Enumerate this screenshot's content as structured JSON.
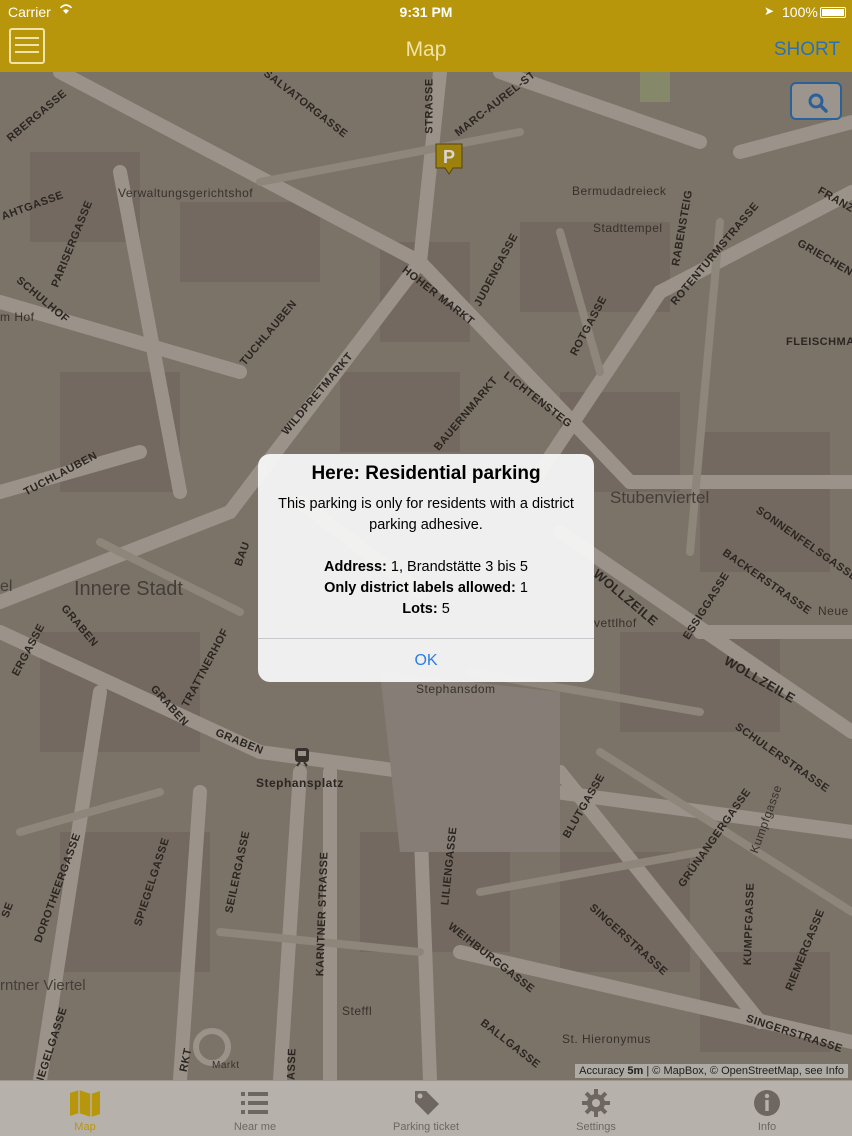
{
  "status": {
    "carrier": "Carrier",
    "time": "9:31 PM",
    "battery": "100%"
  },
  "nav": {
    "title": "Map",
    "right_button": "SHORT"
  },
  "map": {
    "labels": {
      "verwaltung": "Verwaltungsgerichtshof",
      "bermuda": "Bermudadreieck",
      "stadttempel": "Stadttempel",
      "stubenviertel": "Stubenviertel",
      "innere": "Innere Stadt",
      "stephansdom": "Stephansdom",
      "stephansplatz": "Stephansplatz",
      "steffl": "Steffl",
      "hieronymus": "St. Hieronymus",
      "karntner": "rntner Viertel",
      "neue": "Neue",
      "vettlhof": "vettlhof",
      "mhof": "m Hof",
      "el": "el"
    },
    "streets": {
      "salvator": "SALVATORGASSE",
      "marc": "MARC-AUREL-ST",
      "strasse": "STRASSE",
      "hoher": "HOHER MARKT",
      "juden": "JUDENGASSE",
      "rabenst": "RABENSTEIG",
      "rotenturm": "ROTENTURMSTRASSE",
      "rotg": "ROTGASSE",
      "tuchlauben": "TUCHLAUBEN",
      "tuchlauben2": "TUCHLAUBEN",
      "wildpret": "WILDPRETMARKT",
      "bauern": "BAUERNMARKT",
      "lichten": "LICHTENSTEG",
      "parisergasse": "PARISERGASSE",
      "schulhof": "SCHULHOF",
      "rbergasse": "RBERGASSE",
      "ahtgasse": "AHTGASSE",
      "griechen": "GRIECHEN",
      "franz": "FRANZ",
      "fleisch": "FLEISCHMA",
      "sonnenfels": "SONNENFELSGASSE",
      "backer": "BACKERSTRASSE",
      "essig": "ESSIGGASSE",
      "wollzeile": "WOLLZEILE",
      "wollzeile2": "WOLLZEILE",
      "schuler": "SCHULERSTRASSE",
      "graben": "GRABEN",
      "graben2": "GRABEN",
      "graben3": "GRABEN",
      "trattner": "TRATTNERHOF",
      "ergasse": "ERGASSE",
      "dorotheer": "DOROTHEERGASSE",
      "spiegel": "SPIEGELGASSE",
      "spiegel2": "IEGELGASSE",
      "seiler": "SEILERGASSE",
      "karntnerstr": "KARNTNER STRASSE",
      "lilien": "LILIENGASSE",
      "blut": "BLUTGASSE",
      "grunanger": "GRÜNANGERGASSE",
      "kumpf": "KUMPFGASSE",
      "kumpf2": "Kumpfgasse",
      "riemer": "RIEMERGASSE",
      "singer": "SINGERSTRASSE",
      "singer2": "SINGERSTRASSE",
      "weihburg": "WEIHBURGGASSE",
      "ball": "BALLGASSE",
      "se": "SE",
      "bau": "BAU",
      "rkt": "RKT",
      "asse": "ASSE",
      "markt": "Markt"
    },
    "parking_icon": "P",
    "attribution_prefix": "Accuracy ",
    "attribution_accuracy": "5m",
    "attribution_suffix": " | © MapBox, © OpenStreetMap, see Info"
  },
  "alert": {
    "title": "Here: Residential parking",
    "message": "This parking is only for residents with a district parking adhesive.",
    "address_label": "Address:",
    "address_value": " 1, Brandstätte 3 bis 5",
    "district_label": "Only district labels allowed:",
    "district_value": " 1",
    "lots_label": "Lots:",
    "lots_value": " 5",
    "ok": "OK"
  },
  "tabs": [
    {
      "label": "Map",
      "icon": "map-icon",
      "active": true
    },
    {
      "label": "Near me",
      "icon": "list-icon",
      "active": false
    },
    {
      "label": "Parking ticket",
      "icon": "tag-icon",
      "active": false
    },
    {
      "label": "Settings",
      "icon": "gear-icon",
      "active": false
    },
    {
      "label": "Info",
      "icon": "info-icon",
      "active": false
    }
  ],
  "colors": {
    "accent": "#b8960b",
    "link": "#2b6fb8",
    "alert_button": "#2b7de9"
  }
}
